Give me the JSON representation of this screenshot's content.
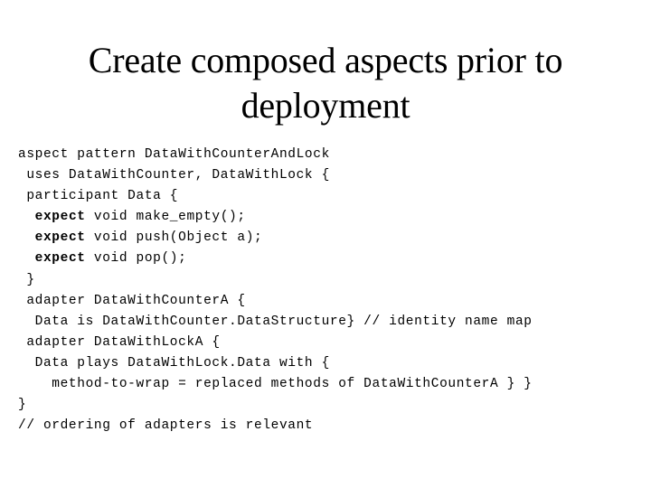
{
  "slide": {
    "title": "Create composed aspects prior to deployment",
    "background_color": "#ffffff",
    "text_color": "#000000"
  },
  "code": {
    "language": "aspect-pattern-dsl",
    "bold_keyword": "expect",
    "lines": [
      {
        "indent": 0,
        "text": "aspect pattern DataWithCounterAndLock",
        "bold_prefix": ""
      },
      {
        "indent": 1,
        "text": "uses DataWithCounter, DataWithLock {",
        "bold_prefix": ""
      },
      {
        "indent": 1,
        "text": "participant Data {",
        "bold_prefix": ""
      },
      {
        "indent": 2,
        "text": " void make_empty();",
        "bold_prefix": "expect"
      },
      {
        "indent": 2,
        "text": " void push(Object a);",
        "bold_prefix": "expect"
      },
      {
        "indent": 2,
        "text": " void pop();",
        "bold_prefix": "expect"
      },
      {
        "indent": 1,
        "text": "}",
        "bold_prefix": ""
      },
      {
        "indent": 1,
        "text": "adapter DataWithCounterA {",
        "bold_prefix": ""
      },
      {
        "indent": 2,
        "text": "Data is DataWithCounter.DataStructure} // identity name map",
        "bold_prefix": ""
      },
      {
        "indent": 1,
        "text": "adapter DataWithLockA {",
        "bold_prefix": ""
      },
      {
        "indent": 2,
        "text": "Data plays DataWithLock.Data with {",
        "bold_prefix": ""
      },
      {
        "indent": 4,
        "text": "method-to-wrap = replaced methods of DataWithCounterA } }",
        "bold_prefix": ""
      },
      {
        "indent": 0,
        "text": "}",
        "bold_prefix": ""
      },
      {
        "indent": 0,
        "text": "// ordering of adapters is relevant",
        "bold_prefix": ""
      }
    ]
  }
}
